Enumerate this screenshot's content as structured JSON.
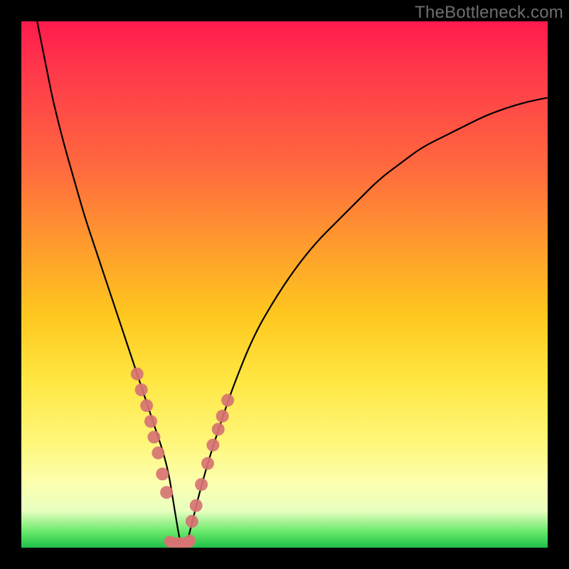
{
  "watermark": "TheBottleneck.com",
  "colors": {
    "frame": "#000000",
    "curve": "#000000",
    "dot": "#d77373",
    "gradient_stops": [
      "#ff1a4d",
      "#ff3a4a",
      "#ff6a3e",
      "#ff9a2e",
      "#ffc81f",
      "#ffe641",
      "#fff77a",
      "#fbffb0",
      "#e8ffbf",
      "#67e86a",
      "#1fc04a"
    ]
  },
  "chart_data": {
    "type": "line",
    "title": "",
    "xlabel": "",
    "ylabel": "",
    "xlim": [
      0,
      100
    ],
    "ylim": [
      0,
      100
    ],
    "x": [
      3,
      4,
      5,
      6,
      8,
      10,
      12,
      14,
      16,
      18,
      20,
      22,
      23,
      24,
      25,
      26,
      27,
      28,
      28.5,
      29,
      29.5,
      30,
      30.5,
      31,
      31.5,
      32,
      33,
      34,
      36,
      38,
      40,
      44,
      48,
      52,
      56,
      60,
      64,
      68,
      72,
      76,
      80,
      84,
      88,
      92,
      96,
      100
    ],
    "values": [
      100,
      95,
      90,
      85,
      77,
      70,
      63,
      57,
      51,
      45,
      39,
      33,
      30,
      27,
      24,
      21,
      18,
      14,
      11,
      8,
      5,
      2,
      0,
      0,
      1,
      3,
      7,
      11,
      18,
      24,
      30,
      40,
      47,
      53,
      58,
      62,
      66,
      70,
      73,
      76,
      78,
      80,
      82,
      83.5,
      84.7,
      85.5
    ],
    "series": [
      {
        "name": "left-branch-markers",
        "x": [
          22.0,
          22.8,
          23.8,
          24.6,
          25.2,
          26.0,
          26.8,
          27.6
        ],
        "values": [
          33.0,
          30.0,
          27.0,
          24.0,
          21.0,
          18.0,
          14.0,
          10.5
        ]
      },
      {
        "name": "right-branch-markers",
        "x": [
          32.4,
          33.2,
          34.2,
          35.4,
          36.4,
          37.4,
          38.2,
          39.2
        ],
        "values": [
          5.0,
          8.0,
          12.0,
          16.0,
          19.5,
          22.5,
          25.0,
          28.0
        ]
      },
      {
        "name": "trough-markers",
        "x": [
          28.2,
          29.2,
          30.2,
          31.2,
          32.0
        ],
        "values": [
          1.2,
          0.8,
          0.8,
          0.8,
          1.4
        ]
      }
    ],
    "annotations": []
  }
}
